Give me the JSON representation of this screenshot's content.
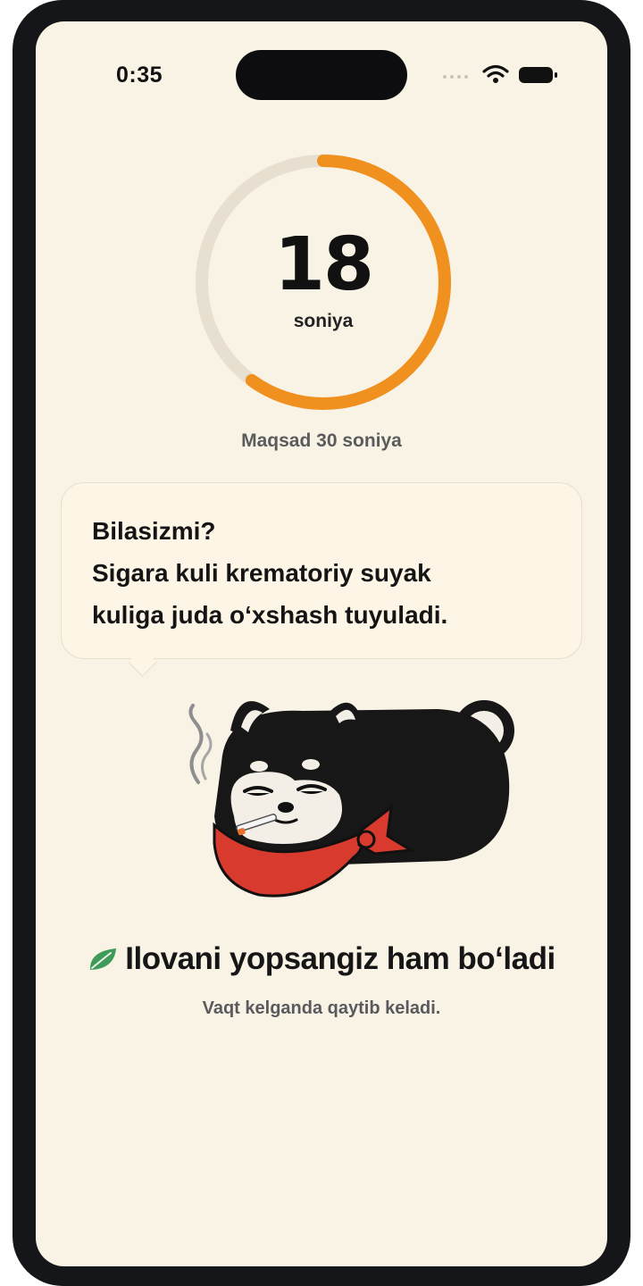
{
  "status_bar": {
    "time": "0:35",
    "icons": [
      "signal-icon",
      "wifi-icon",
      "battery-icon"
    ]
  },
  "timer": {
    "value": "18",
    "unit": "soniya",
    "progress_fraction": 0.6,
    "goal_text": "Maqsad 30 soniya"
  },
  "fact_bubble": {
    "lines": [
      "Bilasizmi?",
      "Sigara kuli krematoriy suyak",
      "kuliga juda o‘xshash tuyuladi."
    ]
  },
  "hint": {
    "icon": "leaf-icon",
    "title": "Ilovani yopsangiz ham bo‘ladi",
    "subtitle": "Vaqt kelganda qaytib keladi."
  },
  "colors": {
    "background": "#f9f3e5",
    "accent": "#f0901f",
    "ring_track": "#e7e0d0",
    "leaf": "#3f9b5a",
    "bandana": "#d83a2e"
  }
}
